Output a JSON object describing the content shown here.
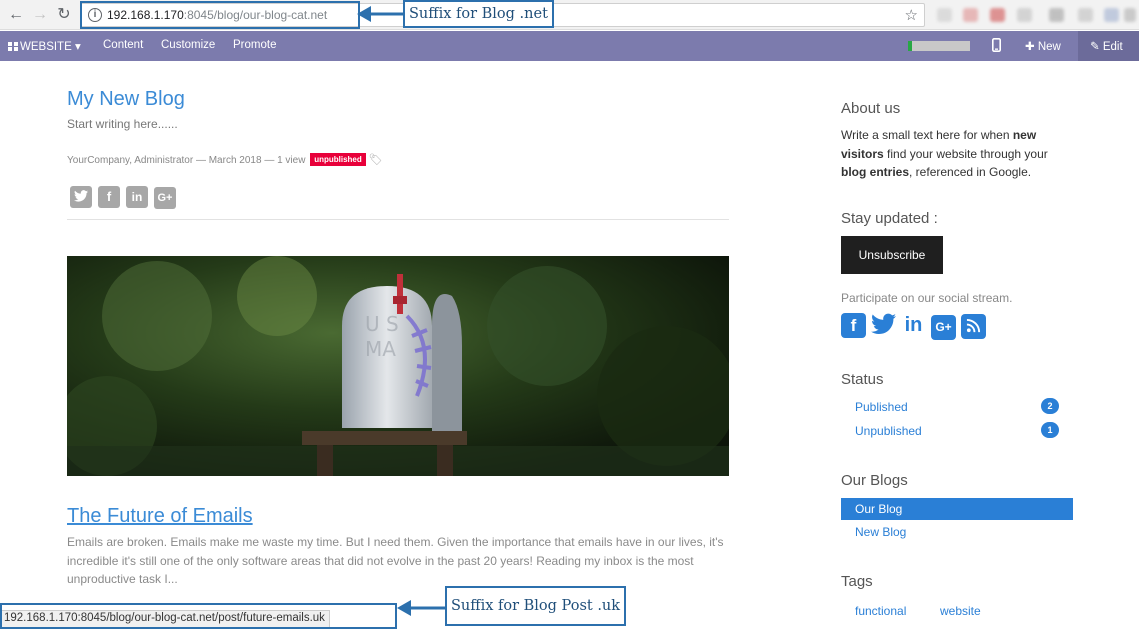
{
  "browser": {
    "url_host": "192.168.1.170",
    "url_rest": ":8045/blog/our-blog-cat.net",
    "star_icon": "star-icon",
    "back_icon": "arrow-left-icon",
    "forward_icon": "arrow-right-icon",
    "reload_icon": "reload-icon"
  },
  "odoo_bar": {
    "website_label": "WEBSITE",
    "dropdown_caret": "▾",
    "content_label": "Content",
    "customize_label": "Customize",
    "promote_label": "Promote",
    "new_label": "New",
    "edit_label": "Edit",
    "progress": 0.06,
    "bar_color": "#7c7bad"
  },
  "blog": {
    "title": "My New Blog",
    "subtitle": "Start writing here......",
    "meta": "YourCompany, Administrator — March 2018 — 1 view",
    "unpublished_badge": "unpublished",
    "share_icons": [
      "twitter-icon",
      "facebook-icon",
      "linkedin-icon",
      "google-plus-icon"
    ],
    "post": {
      "title": "The Future of Emails",
      "excerpt": "Emails are broken. Emails make me waste my time. But I need them. Given the importance that emails have in our lives, it's incredible it's still one of the only software areas that did not evolve in the past 20 years! Reading my inbox is the most unproductive task I..."
    }
  },
  "sidebar": {
    "about_heading": "About us",
    "about_text": {
      "p1": "Write a small text here for when ",
      "b1": "new visitors",
      "p2": " find your website through your ",
      "b2": "blog entries",
      "p3": ", referenced in Google."
    },
    "stay_updated_heading": "Stay updated :",
    "unsubscribe_label": "Unsubscribe",
    "social_note": "Participate on our social stream.",
    "social_icons": [
      "facebook-icon",
      "twitter-icon",
      "linkedin-icon",
      "google-plus-icon",
      "rss-icon"
    ],
    "status_heading": "Status",
    "status_items": [
      {
        "label": "Published",
        "count": "2"
      },
      {
        "label": "Unpublished",
        "count": "1"
      }
    ],
    "our_blogs_heading": "Our Blogs",
    "blogs": [
      {
        "label": "Our Blog",
        "active": true
      },
      {
        "label": "New Blog",
        "active": false
      }
    ],
    "tags_heading": "Tags",
    "tags": [
      "functional",
      "website"
    ],
    "accent_color": "#2a7fd6"
  },
  "annotations": {
    "blog_suffix_label": "Suffix for Blog .net",
    "post_suffix_label": "Suffix for Blog Post .uk",
    "status_url": "192.168.1.170:8045/blog/our-blog-cat.net/post/future-emails.uk",
    "annotation_color": "#2c70ad"
  }
}
